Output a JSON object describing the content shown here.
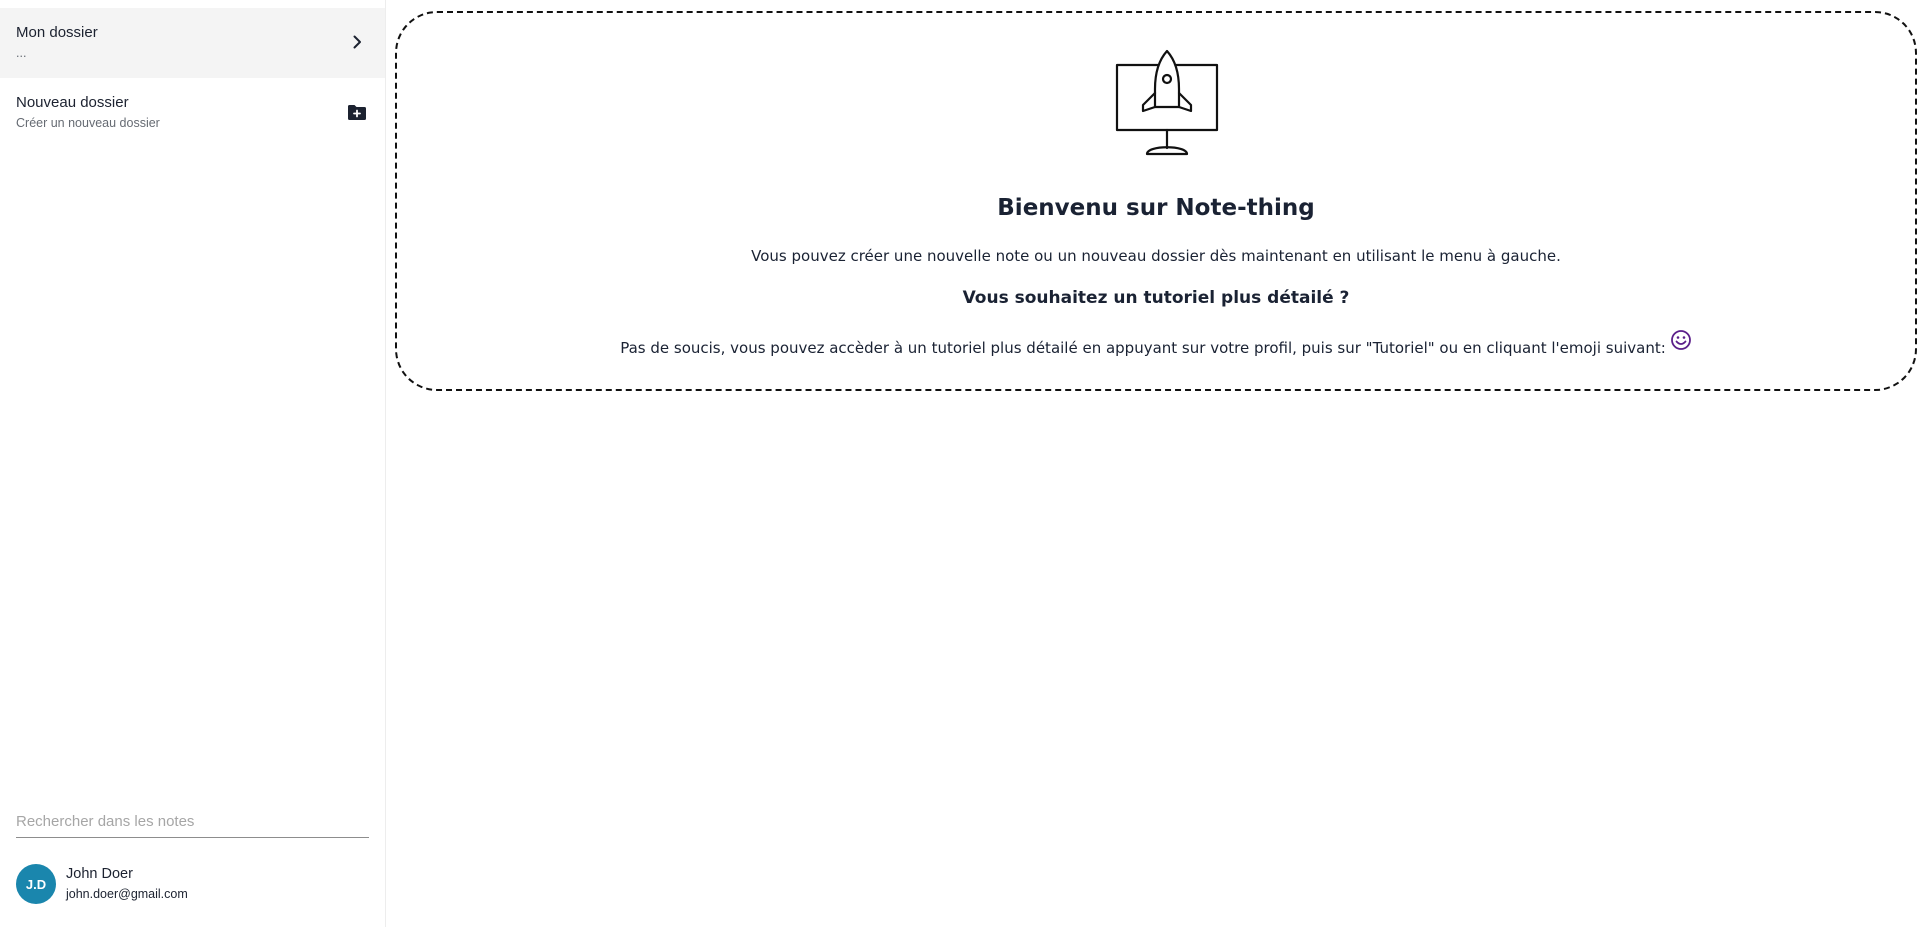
{
  "sidebar": {
    "folders": [
      {
        "title": "Mon dossier",
        "subtitle": "...",
        "icon": "chevron-right-icon"
      },
      {
        "title": "Nouveau dossier",
        "subtitle": "Créer un nouveau dossier",
        "icon": "folder-add-icon"
      }
    ],
    "search": {
      "placeholder": "Rechercher dans les notes",
      "value": ""
    },
    "profile": {
      "initials": "J.D",
      "name": "John Doer",
      "email": "john.doer@gmail.com",
      "avatar_color": "#1a86ad"
    }
  },
  "main": {
    "illustration_icon": "rocket-monitor-icon",
    "title": "Bienvenu sur Note-thing",
    "intro": "Vous pouvez créer une nouvelle note ou un nouveau dossier dès maintenant en utilisant le menu à gauche.",
    "tutorial_title": "Vous souhaitez un tutoriel plus détailé ?",
    "tutorial_text": "Pas de soucis, vous pouvez accèder à un tutoriel plus détailé en appuyant sur votre profil, puis sur \"Tutoriel\" ou en cliquant l'emoji suivant:",
    "emoji_icon": "smiley-icon",
    "emoji_color": "#5b1f8a"
  }
}
